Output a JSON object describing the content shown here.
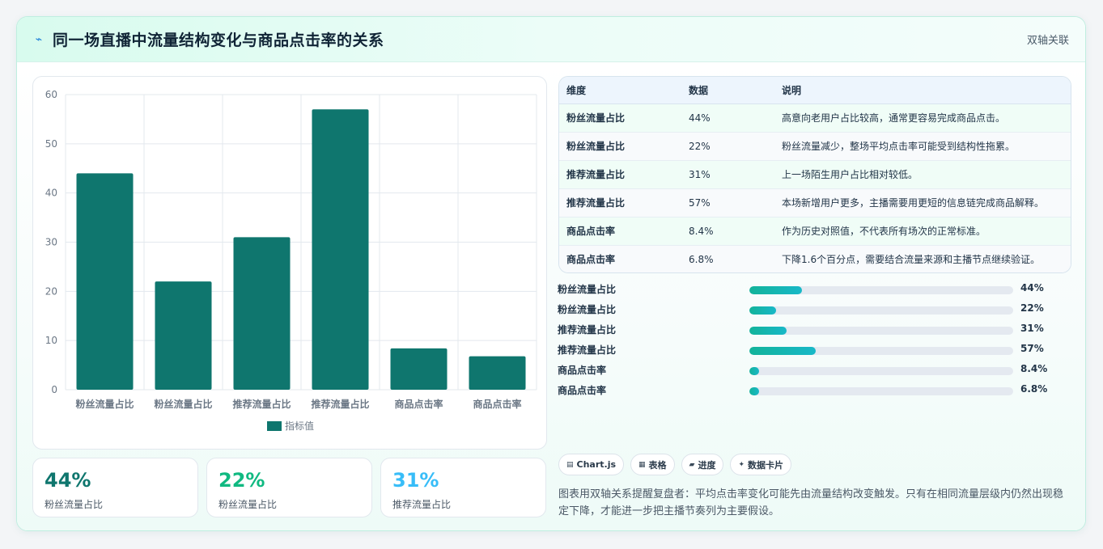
{
  "header": {
    "title": "同一场直播中流量结构变化与商品点击率的关系",
    "tag": "双轴关联",
    "icon": "trend-line-icon"
  },
  "chart_data": {
    "type": "bar",
    "categories": [
      "粉丝流量占比",
      "粉丝流量占比",
      "推荐流量占比",
      "推荐流量占比",
      "商品点击率",
      "商品点击率"
    ],
    "series": [
      {
        "name": "指标值",
        "values": [
          44,
          22,
          31,
          57,
          8.4,
          6.8
        ],
        "color": "#0f766e"
      }
    ],
    "ylim": [
      0,
      60
    ],
    "yticks": [
      0,
      10,
      20,
      30,
      40,
      50,
      60
    ],
    "grid": true,
    "legend": "bottom"
  },
  "stats": [
    {
      "value": "44%",
      "label": "粉丝流量占比",
      "color": "#0f766e"
    },
    {
      "value": "22%",
      "label": "粉丝流量占比",
      "color": "#10b981"
    },
    {
      "value": "31%",
      "label": "推荐流量占比",
      "color": "#38bdf8"
    }
  ],
  "table": {
    "headers": [
      "维度",
      "数据",
      "说明"
    ],
    "rows": [
      [
        "粉丝流量占比",
        "44%",
        "高意向老用户占比较高，通常更容易完成商品点击。"
      ],
      [
        "粉丝流量占比",
        "22%",
        "粉丝流量减少，整场平均点击率可能受到结构性拖累。"
      ],
      [
        "推荐流量占比",
        "31%",
        "上一场陌生用户占比相对较低。"
      ],
      [
        "推荐流量占比",
        "57%",
        "本场新增用户更多，主播需要用更短的信息链完成商品解释。"
      ],
      [
        "商品点击率",
        "8.4%",
        "作为历史对照值，不代表所有场次的正常标准。"
      ],
      [
        "商品点击率",
        "6.8%",
        "下降1.6个百分点，需要结合流量来源和主播节点继续验证。"
      ]
    ]
  },
  "progress": [
    {
      "label": "粉丝流量占比",
      "value": "44%",
      "fraction": 0.2
    },
    {
      "label": "粉丝流量占比",
      "value": "22%",
      "fraction": 0.1
    },
    {
      "label": "推荐流量占比",
      "value": "31%",
      "fraction": 0.14
    },
    {
      "label": "推荐流量占比",
      "value": "57%",
      "fraction": 0.25
    },
    {
      "label": "商品点击率",
      "value": "8.4%",
      "fraction": 0.037
    },
    {
      "label": "商品点击率",
      "value": "6.8%",
      "fraction": 0.037
    }
  ],
  "pills": [
    {
      "icon": "chart-icon",
      "glyph": "▤",
      "label": "Chart.js"
    },
    {
      "icon": "table-icon",
      "glyph": "▦",
      "label": "表格"
    },
    {
      "icon": "progress-icon",
      "glyph": "▰",
      "label": "进度"
    },
    {
      "icon": "sparkle-icon",
      "glyph": "✦",
      "label": "数据卡片"
    }
  ],
  "note": "图表用双轴关系提醒复盘者：平均点击率变化可能先由流量结构改变触发。只有在相同流量层级内仍然出现稳定下降，才能进一步把主播节奏列为主要假设。"
}
